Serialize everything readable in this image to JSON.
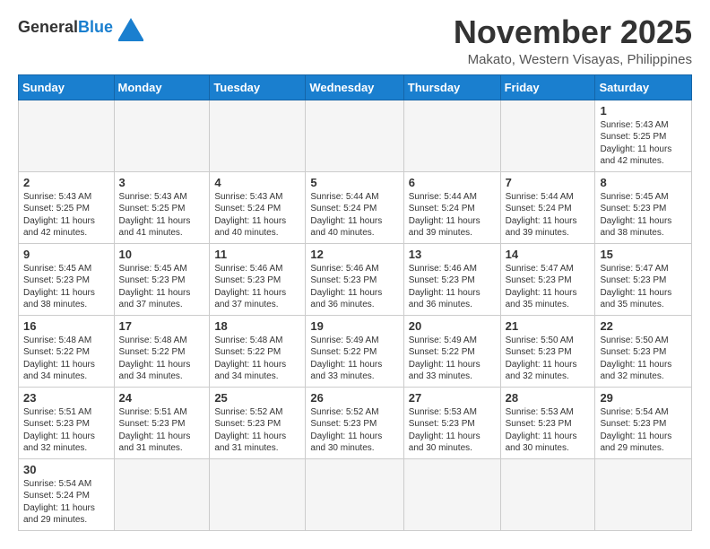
{
  "header": {
    "logo_line1": "General",
    "logo_line2": "Blue",
    "month": "November 2025",
    "location": "Makato, Western Visayas, Philippines"
  },
  "weekdays": [
    "Sunday",
    "Monday",
    "Tuesday",
    "Wednesday",
    "Thursday",
    "Friday",
    "Saturday"
  ],
  "weeks": [
    [
      {
        "day": "",
        "info": ""
      },
      {
        "day": "",
        "info": ""
      },
      {
        "day": "",
        "info": ""
      },
      {
        "day": "",
        "info": ""
      },
      {
        "day": "",
        "info": ""
      },
      {
        "day": "",
        "info": ""
      },
      {
        "day": "1",
        "info": "Sunrise: 5:43 AM\nSunset: 5:25 PM\nDaylight: 11 hours\nand 42 minutes."
      }
    ],
    [
      {
        "day": "2",
        "info": "Sunrise: 5:43 AM\nSunset: 5:25 PM\nDaylight: 11 hours\nand 42 minutes."
      },
      {
        "day": "3",
        "info": "Sunrise: 5:43 AM\nSunset: 5:25 PM\nDaylight: 11 hours\nand 41 minutes."
      },
      {
        "day": "4",
        "info": "Sunrise: 5:43 AM\nSunset: 5:24 PM\nDaylight: 11 hours\nand 40 minutes."
      },
      {
        "day": "5",
        "info": "Sunrise: 5:44 AM\nSunset: 5:24 PM\nDaylight: 11 hours\nand 40 minutes."
      },
      {
        "day": "6",
        "info": "Sunrise: 5:44 AM\nSunset: 5:24 PM\nDaylight: 11 hours\nand 39 minutes."
      },
      {
        "day": "7",
        "info": "Sunrise: 5:44 AM\nSunset: 5:24 PM\nDaylight: 11 hours\nand 39 minutes."
      },
      {
        "day": "8",
        "info": "Sunrise: 5:45 AM\nSunset: 5:23 PM\nDaylight: 11 hours\nand 38 minutes."
      }
    ],
    [
      {
        "day": "9",
        "info": "Sunrise: 5:45 AM\nSunset: 5:23 PM\nDaylight: 11 hours\nand 38 minutes."
      },
      {
        "day": "10",
        "info": "Sunrise: 5:45 AM\nSunset: 5:23 PM\nDaylight: 11 hours\nand 37 minutes."
      },
      {
        "day": "11",
        "info": "Sunrise: 5:46 AM\nSunset: 5:23 PM\nDaylight: 11 hours\nand 37 minutes."
      },
      {
        "day": "12",
        "info": "Sunrise: 5:46 AM\nSunset: 5:23 PM\nDaylight: 11 hours\nand 36 minutes."
      },
      {
        "day": "13",
        "info": "Sunrise: 5:46 AM\nSunset: 5:23 PM\nDaylight: 11 hours\nand 36 minutes."
      },
      {
        "day": "14",
        "info": "Sunrise: 5:47 AM\nSunset: 5:23 PM\nDaylight: 11 hours\nand 35 minutes."
      },
      {
        "day": "15",
        "info": "Sunrise: 5:47 AM\nSunset: 5:23 PM\nDaylight: 11 hours\nand 35 minutes."
      }
    ],
    [
      {
        "day": "16",
        "info": "Sunrise: 5:48 AM\nSunset: 5:22 PM\nDaylight: 11 hours\nand 34 minutes."
      },
      {
        "day": "17",
        "info": "Sunrise: 5:48 AM\nSunset: 5:22 PM\nDaylight: 11 hours\nand 34 minutes."
      },
      {
        "day": "18",
        "info": "Sunrise: 5:48 AM\nSunset: 5:22 PM\nDaylight: 11 hours\nand 34 minutes."
      },
      {
        "day": "19",
        "info": "Sunrise: 5:49 AM\nSunset: 5:22 PM\nDaylight: 11 hours\nand 33 minutes."
      },
      {
        "day": "20",
        "info": "Sunrise: 5:49 AM\nSunset: 5:22 PM\nDaylight: 11 hours\nand 33 minutes."
      },
      {
        "day": "21",
        "info": "Sunrise: 5:50 AM\nSunset: 5:23 PM\nDaylight: 11 hours\nand 32 minutes."
      },
      {
        "day": "22",
        "info": "Sunrise: 5:50 AM\nSunset: 5:23 PM\nDaylight: 11 hours\nand 32 minutes."
      }
    ],
    [
      {
        "day": "23",
        "info": "Sunrise: 5:51 AM\nSunset: 5:23 PM\nDaylight: 11 hours\nand 32 minutes."
      },
      {
        "day": "24",
        "info": "Sunrise: 5:51 AM\nSunset: 5:23 PM\nDaylight: 11 hours\nand 31 minutes."
      },
      {
        "day": "25",
        "info": "Sunrise: 5:52 AM\nSunset: 5:23 PM\nDaylight: 11 hours\nand 31 minutes."
      },
      {
        "day": "26",
        "info": "Sunrise: 5:52 AM\nSunset: 5:23 PM\nDaylight: 11 hours\nand 30 minutes."
      },
      {
        "day": "27",
        "info": "Sunrise: 5:53 AM\nSunset: 5:23 PM\nDaylight: 11 hours\nand 30 minutes."
      },
      {
        "day": "28",
        "info": "Sunrise: 5:53 AM\nSunset: 5:23 PM\nDaylight: 11 hours\nand 30 minutes."
      },
      {
        "day": "29",
        "info": "Sunrise: 5:54 AM\nSunset: 5:23 PM\nDaylight: 11 hours\nand 29 minutes."
      }
    ],
    [
      {
        "day": "30",
        "info": "Sunrise: 5:54 AM\nSunset: 5:24 PM\nDaylight: 11 hours\nand 29 minutes."
      },
      {
        "day": "",
        "info": ""
      },
      {
        "day": "",
        "info": ""
      },
      {
        "day": "",
        "info": ""
      },
      {
        "day": "",
        "info": ""
      },
      {
        "day": "",
        "info": ""
      },
      {
        "day": "",
        "info": ""
      }
    ]
  ]
}
